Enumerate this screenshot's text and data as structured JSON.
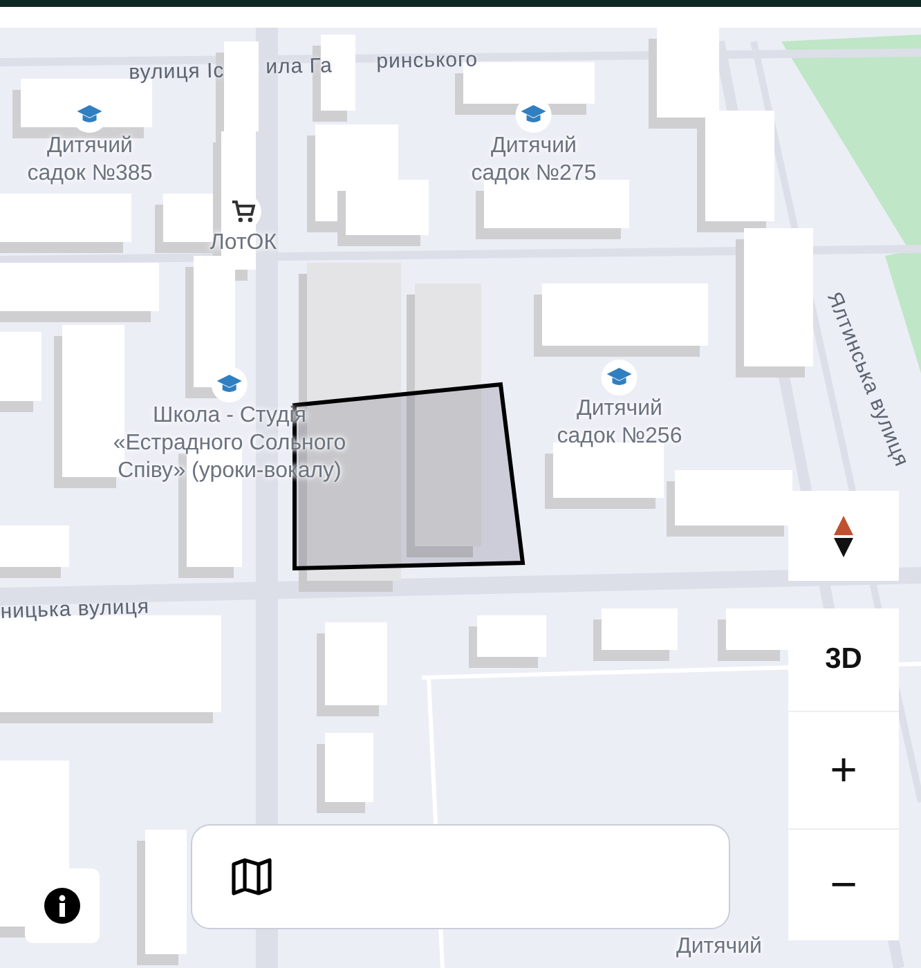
{
  "map": {
    "streets": [
      {
        "text": "вулиця Іс"
      },
      {
        "text": "ила Га"
      },
      {
        "text": "ринського"
      },
      {
        "text": "ницька вулиця"
      },
      {
        "text": "Ялтинська вулиця"
      }
    ],
    "pois": [
      {
        "kind": "school",
        "name": "Дитячий\nсадок №385"
      },
      {
        "kind": "school",
        "name": "Дитячий\nсадок №275"
      },
      {
        "kind": "shop",
        "name": "ЛотОК"
      },
      {
        "kind": "school",
        "name": "Школа - Студія\n«Естрадного Сольного\nСпіву» (уроки-вокалу)"
      },
      {
        "kind": "school",
        "name": "Дитячий\nсадок №256"
      },
      {
        "kind": "label",
        "name": "Дитячий"
      }
    ]
  },
  "controls": {
    "view_mode": "3D",
    "zoom_in": "+",
    "zoom_out": "−"
  }
}
